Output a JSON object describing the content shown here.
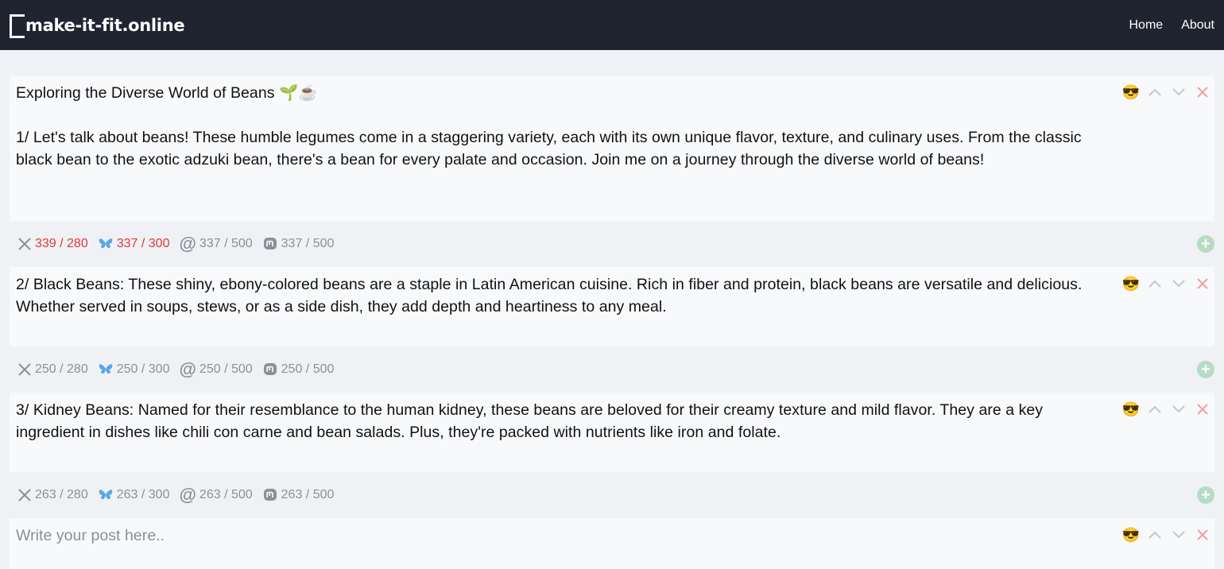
{
  "brand": {
    "name": "make-it-fit.online"
  },
  "nav": {
    "home": "Home",
    "about": "About"
  },
  "posts": [
    {
      "text": "Exploring the Diverse World of Beans 🌱☕\n\n1/ Let's talk about beans! These humble legumes come in a staggering variety, each with its own unique flavor, texture, and culinary uses. From the classic black bean to the exotic adzuki bean, there's a bean for every palate and occasion. Join me on a journey through the diverse world of beans!",
      "stats": {
        "x": "339 / 280",
        "bluesky": "337 / 300",
        "threads": "337 / 500",
        "mastodon": "337 / 500"
      },
      "over": {
        "x": true,
        "bluesky": true,
        "threads": false,
        "mastodon": false
      }
    },
    {
      "text": "2/ Black Beans: These shiny, ebony-colored beans are a staple in Latin American cuisine. Rich in fiber and protein, black beans are versatile and delicious. Whether served in soups, stews, or as a side dish, they add depth and heartiness to any meal.",
      "stats": {
        "x": "250 / 280",
        "bluesky": "250 / 300",
        "threads": "250 / 500",
        "mastodon": "250 / 500"
      },
      "over": {
        "x": false,
        "bluesky": false,
        "threads": false,
        "mastodon": false
      }
    },
    {
      "text": "3/ Kidney Beans: Named for their resemblance to the human kidney, these beans are beloved for their creamy texture and mild flavor. They are a key ingredient in dishes like chili con carne and bean salads. Plus, they're packed with nutrients like iron and folate.",
      "stats": {
        "x": "263 / 280",
        "bluesky": "263 / 300",
        "threads": "263 / 500",
        "mastodon": "263 / 500"
      },
      "over": {
        "x": false,
        "bluesky": false,
        "threads": false,
        "mastodon": false
      }
    }
  ],
  "new_post": {
    "placeholder": "Write your post here.."
  },
  "icons": {
    "emoji_button": "😎",
    "move_up": "chevron-up-icon",
    "move_down": "chevron-down-icon",
    "delete": "close-icon",
    "add": "+",
    "x": "x-logo-icon",
    "bluesky": "butterfly-icon",
    "threads": "threads-at-icon",
    "mastodon": "mastodon-icon"
  },
  "colors": {
    "navbar": "#1f2430",
    "over_limit": "#dc3a3a",
    "stat_text": "#8b9099",
    "delete": "#f0a0a0",
    "add_button": "#b6dcc4",
    "bluesky": "#5aa6e8"
  }
}
